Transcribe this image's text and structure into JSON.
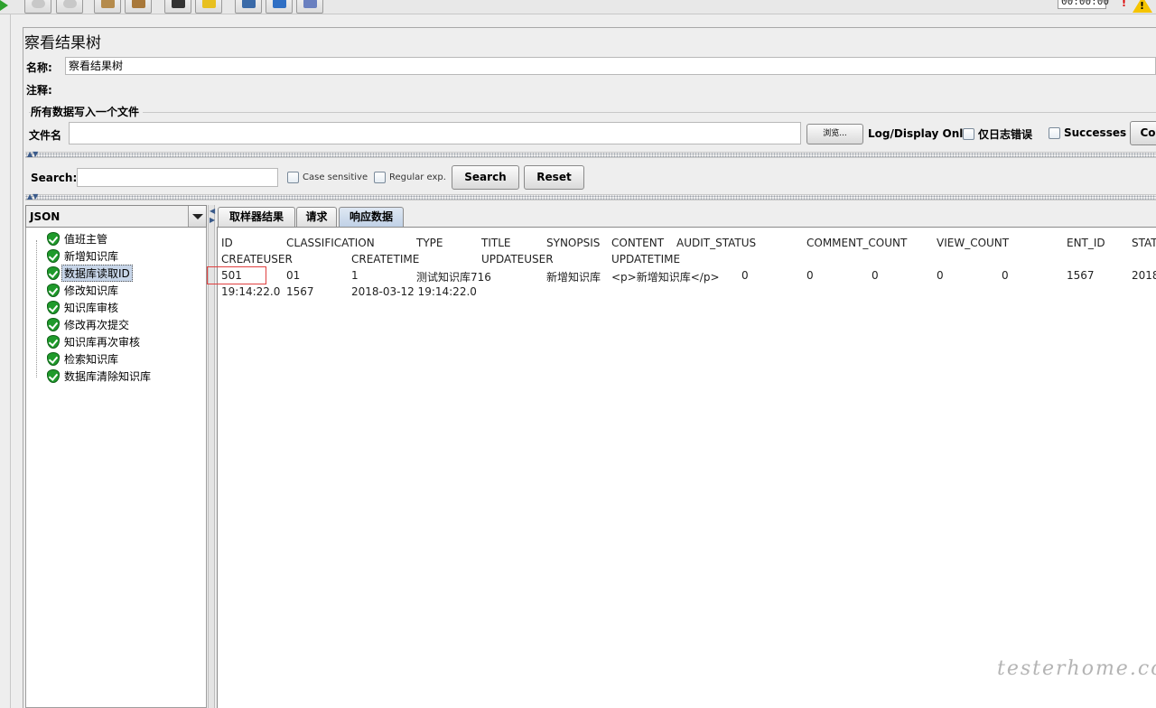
{
  "toolbar": {
    "timer": "00:00:00",
    "error_mark": "!",
    "warning_mark": "!",
    "buttons": [
      {
        "name": "start-no-pause-button",
        "icon": "gray-circle-icon"
      },
      {
        "name": "stop-button",
        "icon": "gray-circle-icon"
      },
      {
        "name": "clear-button",
        "icon": "broom-icon"
      },
      {
        "name": "clear-all-button",
        "icon": "broom-icon"
      },
      {
        "name": "search-button",
        "icon": "binoculars-icon"
      },
      {
        "name": "reset-search-button",
        "icon": "tag-icon"
      },
      {
        "name": "function-helper-button",
        "icon": "list-icon"
      },
      {
        "name": "help-button",
        "icon": "info-icon"
      },
      {
        "name": "remote-button",
        "icon": "network-icon"
      }
    ]
  },
  "panel": {
    "title": "察看结果树",
    "name_label": "名称:",
    "name_value": "察看结果树",
    "comment_label": "注释:",
    "comment_value": "",
    "file_group_title": "所有数据写入一个文件",
    "filename_label": "文件名",
    "filename_value": "",
    "browse_label": "浏览...",
    "log_display_label": "Log/Display Only:",
    "errors_only_label": "仅日志错误",
    "successes_label": "Successes",
    "configure_label": "Co"
  },
  "search": {
    "label": "Search:",
    "value": "",
    "case_sensitive_label": "Case sensitive",
    "regex_label": "Regular exp.",
    "search_button": "Search",
    "reset_button": "Reset"
  },
  "tree": {
    "renderer": "JSON",
    "items": [
      {
        "label": "值班主管",
        "selected": false
      },
      {
        "label": "新增知识库",
        "selected": false
      },
      {
        "label": "数据库读取ID",
        "selected": true
      },
      {
        "label": "修改知识库",
        "selected": false
      },
      {
        "label": "知识库审核",
        "selected": false
      },
      {
        "label": "修改再次提交",
        "selected": false
      },
      {
        "label": "知识库再次审核",
        "selected": false
      },
      {
        "label": "检索知识库",
        "selected": false
      },
      {
        "label": "数据库清除知识库",
        "selected": false
      }
    ]
  },
  "tabs": [
    {
      "label": "取样器结果",
      "active": false
    },
    {
      "label": "请求",
      "active": false
    },
    {
      "label": "响应数据",
      "active": true
    }
  ],
  "response": {
    "header_row1": [
      "ID",
      "CLASSIFICATION",
      "TYPE",
      "TITLE",
      "SYNOPSIS",
      "CONTENT",
      "AUDIT_STATUS",
      "COMMENT_COUNT",
      "VIEW_COUNT",
      "ENT_ID",
      "STAT"
    ],
    "header_row2": [
      "CREATEUSER",
      "CREATETIME",
      "UPDATEUSER",
      "UPDATETIME"
    ],
    "data_row1": [
      "501",
      "01",
      "1",
      "测试知识库716",
      "新增知识库",
      "<p>新增知识库</p>",
      "0",
      "0",
      "0",
      "0",
      "0",
      "1567",
      "2018"
    ],
    "data_row2": [
      "19:14:22.0",
      "1567",
      "2018-03-12 19:14:22.0"
    ]
  },
  "watermark": "testerhome.com"
}
